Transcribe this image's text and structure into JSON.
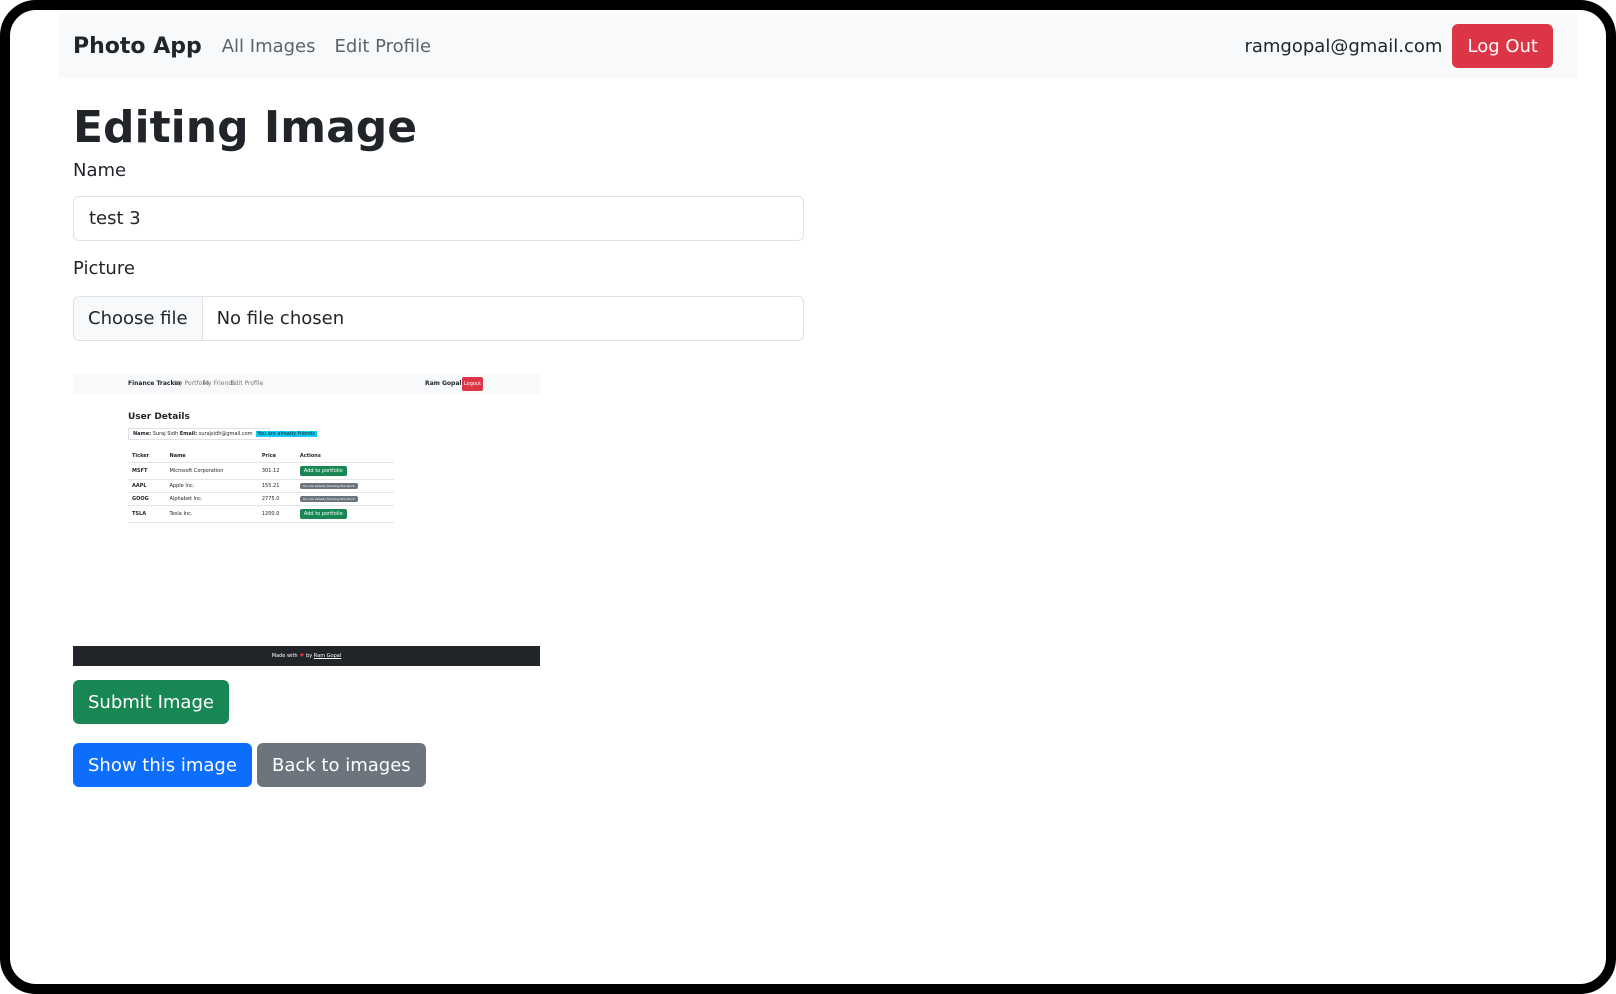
{
  "navbar": {
    "brand": "Photo App",
    "links": [
      "All Images",
      "Edit Profile"
    ],
    "user_email": "ramgopal@gmail.com",
    "logout_label": "Log Out"
  },
  "page": {
    "title": "Editing Image"
  },
  "form": {
    "name_label": "Name",
    "name_value": "test 3",
    "picture_label": "Picture",
    "file_button": "Choose file",
    "file_status": "No file chosen",
    "submit_label": "Submit Image"
  },
  "actions": {
    "show_label": "Show this image",
    "back_label": "Back to images"
  },
  "preview": {
    "nav_brand": "Finance Tracker",
    "nav_links": [
      "My Portfolio",
      "My Friends",
      "Edit Profile"
    ],
    "nav_user": "Ram Gopal",
    "nav_logout": "Logout",
    "title": "User Details",
    "user_name_label": "Name:",
    "user_name": "Suraj Sidh",
    "user_email_label": "Email:",
    "user_email": "surajsidh@gmail.com",
    "badge": "You are already friends",
    "columns": [
      "Ticker",
      "Name",
      "Price",
      "Actions"
    ],
    "rows": [
      {
        "ticker": "MSFT",
        "name": "Microsoft Corporation",
        "price": "301.12",
        "action": "Add to portfolio",
        "action_type": "add"
      },
      {
        "ticker": "AAPL",
        "name": "Apple Inc.",
        "price": "155.21",
        "action": "You are already tracking this stock",
        "action_type": "tracking"
      },
      {
        "ticker": "GOOG",
        "name": "Alphabet Inc.",
        "price": "2775.0",
        "action": "You are already tracking this stock",
        "action_type": "tracking"
      },
      {
        "ticker": "TSLA",
        "name": "Tesla Inc.",
        "price": "1200.0",
        "action": "Add to portfolio",
        "action_type": "add"
      }
    ],
    "footer_prefix": "Made with",
    "footer_mid": "by",
    "footer_author": "Ram Gopal"
  },
  "colors": {
    "danger": "#dc3545",
    "success": "#198754",
    "primary": "#0d6efd",
    "secondary": "#6c757d"
  }
}
